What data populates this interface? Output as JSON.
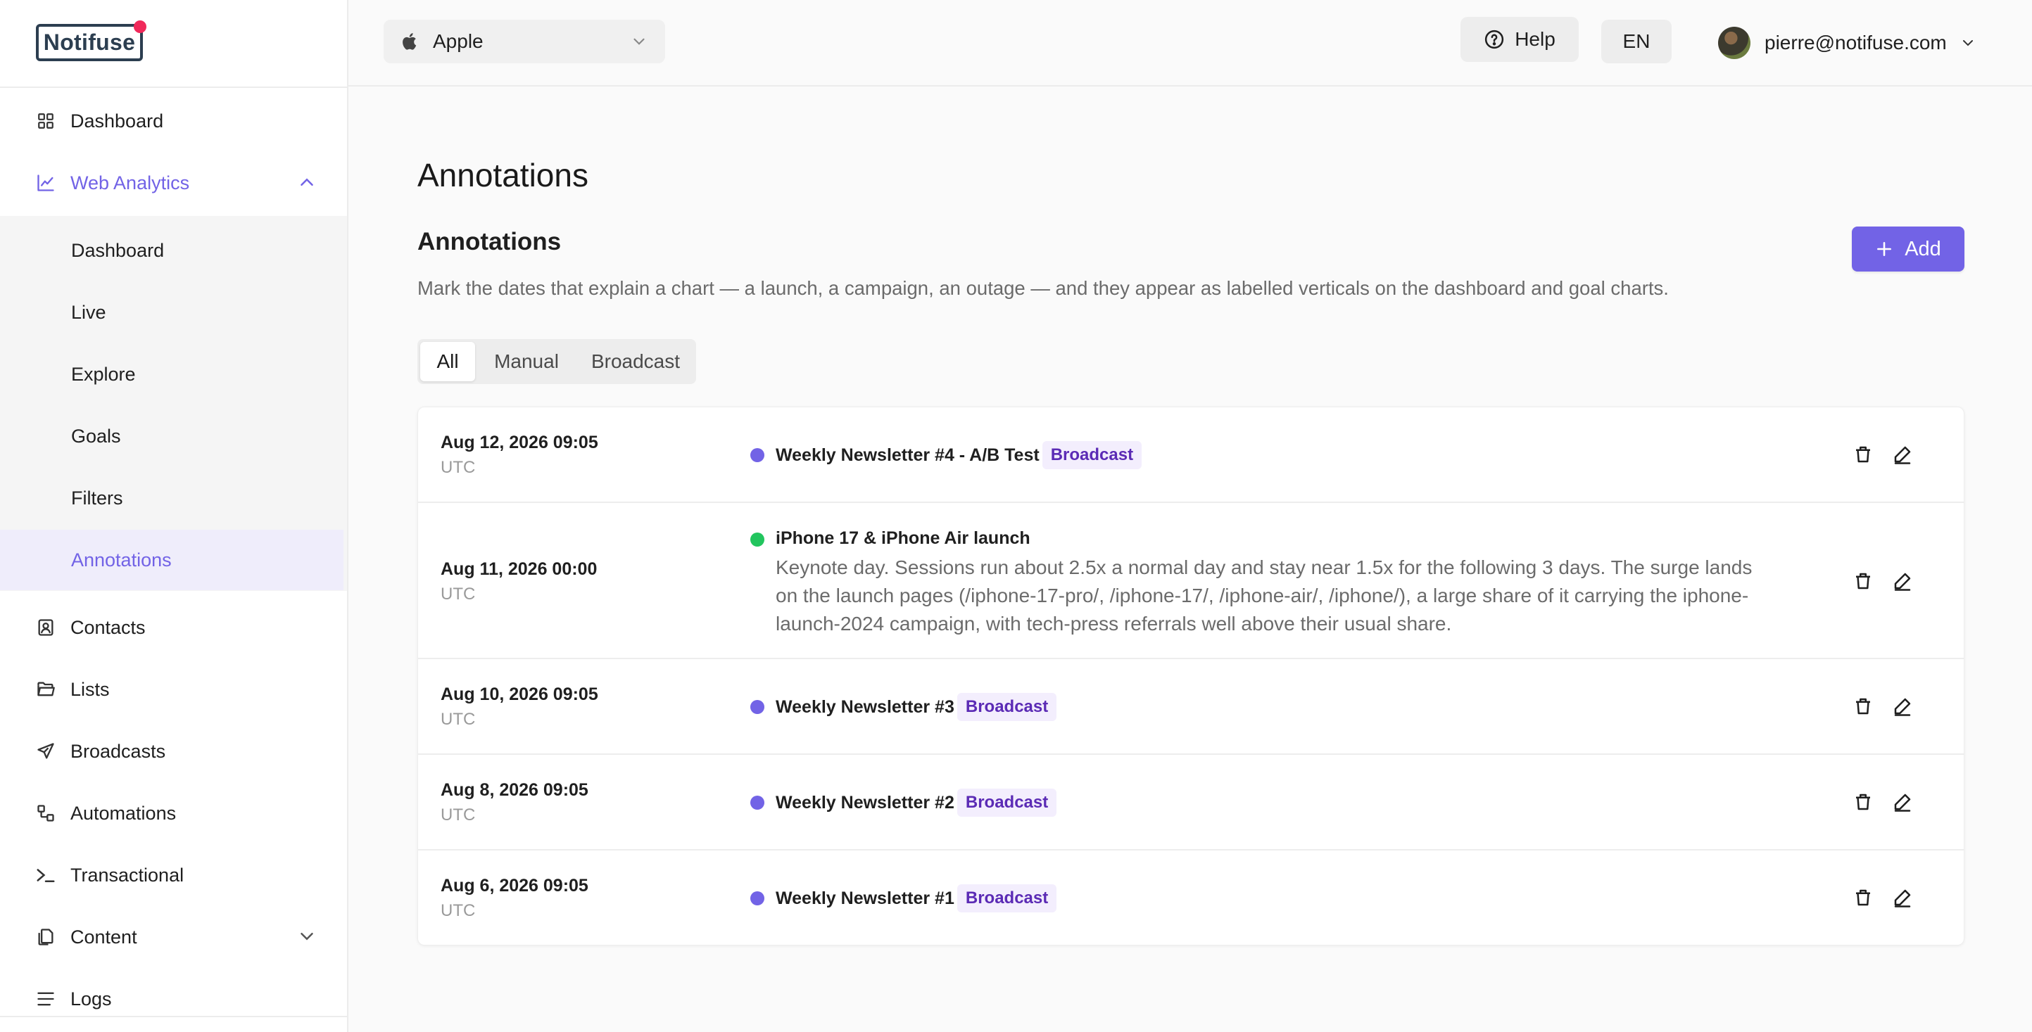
{
  "app": {
    "logo_text": "Notifuse",
    "colors": {
      "accent": "#7263e6",
      "logo_dot": "#f0295a",
      "status_purple": "#7263e6",
      "status_green": "#22c55e"
    }
  },
  "sidebar": {
    "items": [
      {
        "label": "Dashboard",
        "icon": "grid-icon"
      },
      {
        "label": "Web Analytics",
        "icon": "line-chart-icon",
        "expanded": true
      },
      {
        "label": "Contacts",
        "icon": "contact-card-icon"
      },
      {
        "label": "Lists",
        "icon": "folder-open-icon"
      },
      {
        "label": "Broadcasts",
        "icon": "paper-plane-icon"
      },
      {
        "label": "Automations",
        "icon": "workflow-icon"
      },
      {
        "label": "Transactional",
        "icon": "terminal-icon"
      },
      {
        "label": "Content",
        "icon": "copy-icon"
      },
      {
        "label": "Logs",
        "icon": "list-lines-icon"
      }
    ],
    "sub_items": [
      {
        "label": "Dashboard"
      },
      {
        "label": "Live"
      },
      {
        "label": "Explore"
      },
      {
        "label": "Goals"
      },
      {
        "label": "Filters"
      },
      {
        "label": "Annotations",
        "active": true
      }
    ]
  },
  "topbar": {
    "project": "Apple",
    "help_label": "Help",
    "language": "EN",
    "user_email": "pierre@notifuse.com"
  },
  "main": {
    "page_title": "Annotations",
    "section_title": "Annotations",
    "description": "Mark the dates that explain a chart — a launch, a campaign, an outage — and they appear as labelled verticals on the dashboard and goal charts.",
    "add_label": "Add",
    "filters": [
      "All",
      "Manual",
      "Broadcast"
    ],
    "active_filter": "All",
    "rows": [
      {
        "date": "Aug 12, 2026 09:05",
        "tz": "UTC",
        "title": "Weekly Newsletter #4 - A/B Test",
        "tag": "Broadcast",
        "color": "#7263e6",
        "desc": ""
      },
      {
        "date": "Aug 11, 2026 00:00",
        "tz": "UTC",
        "title": "iPhone 17 & iPhone Air launch",
        "tag": "",
        "color": "#22c55e",
        "desc_lines": [
          "Keynote day. Sessions run about 2.5x a normal day and stay near 1.5x for the following 3 days. The surge lands",
          "on the launch pages (/iphone-17-pro/, /iphone-17/, /iphone-air/, /iphone/), a large share of it carrying the iphone-",
          "launch-2024 campaign, with tech-press referrals well above their usual share."
        ]
      },
      {
        "date": "Aug 10, 2026 09:05",
        "tz": "UTC",
        "title": "Weekly Newsletter #3",
        "tag": "Broadcast",
        "color": "#7263e6",
        "desc": ""
      },
      {
        "date": "Aug 8, 2026 09:05",
        "tz": "UTC",
        "title": "Weekly Newsletter #2",
        "tag": "Broadcast",
        "color": "#7263e6",
        "desc": ""
      },
      {
        "date": "Aug 6, 2026 09:05",
        "tz": "UTC",
        "title": "Weekly Newsletter #1",
        "tag": "Broadcast",
        "color": "#7263e6",
        "desc": ""
      }
    ]
  }
}
